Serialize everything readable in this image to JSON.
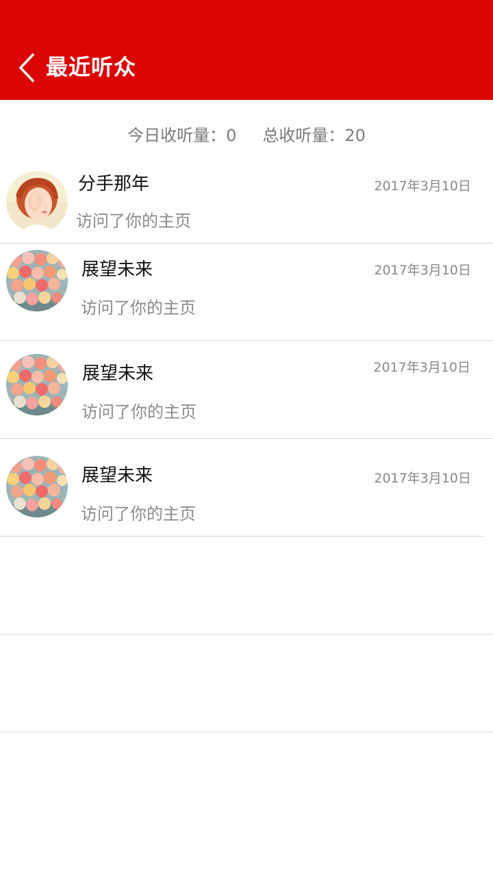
{
  "header": {
    "title": "最近听众",
    "back_icon": "chevron-left-icon",
    "background": "#dc0505"
  },
  "stats": {
    "today_label": "今日收听量：0",
    "total_label": "总收听量：20"
  },
  "listeners": [
    {
      "name": "分手那年",
      "date": "2017年3月10日",
      "action": "访问了你的主页",
      "avatar": "girl-photo"
    },
    {
      "name": "展望未来",
      "date": "2017年3月10日",
      "action": "访问了你的主页",
      "avatar": "balloons-photo"
    },
    {
      "name": "展望未来",
      "date": "2017年3月10日",
      "action": "访问了你的主页",
      "avatar": "balloons-photo"
    },
    {
      "name": "展望未来",
      "date": "2017年3月10日",
      "action": "访问了你的主页",
      "avatar": "balloons-photo"
    }
  ]
}
